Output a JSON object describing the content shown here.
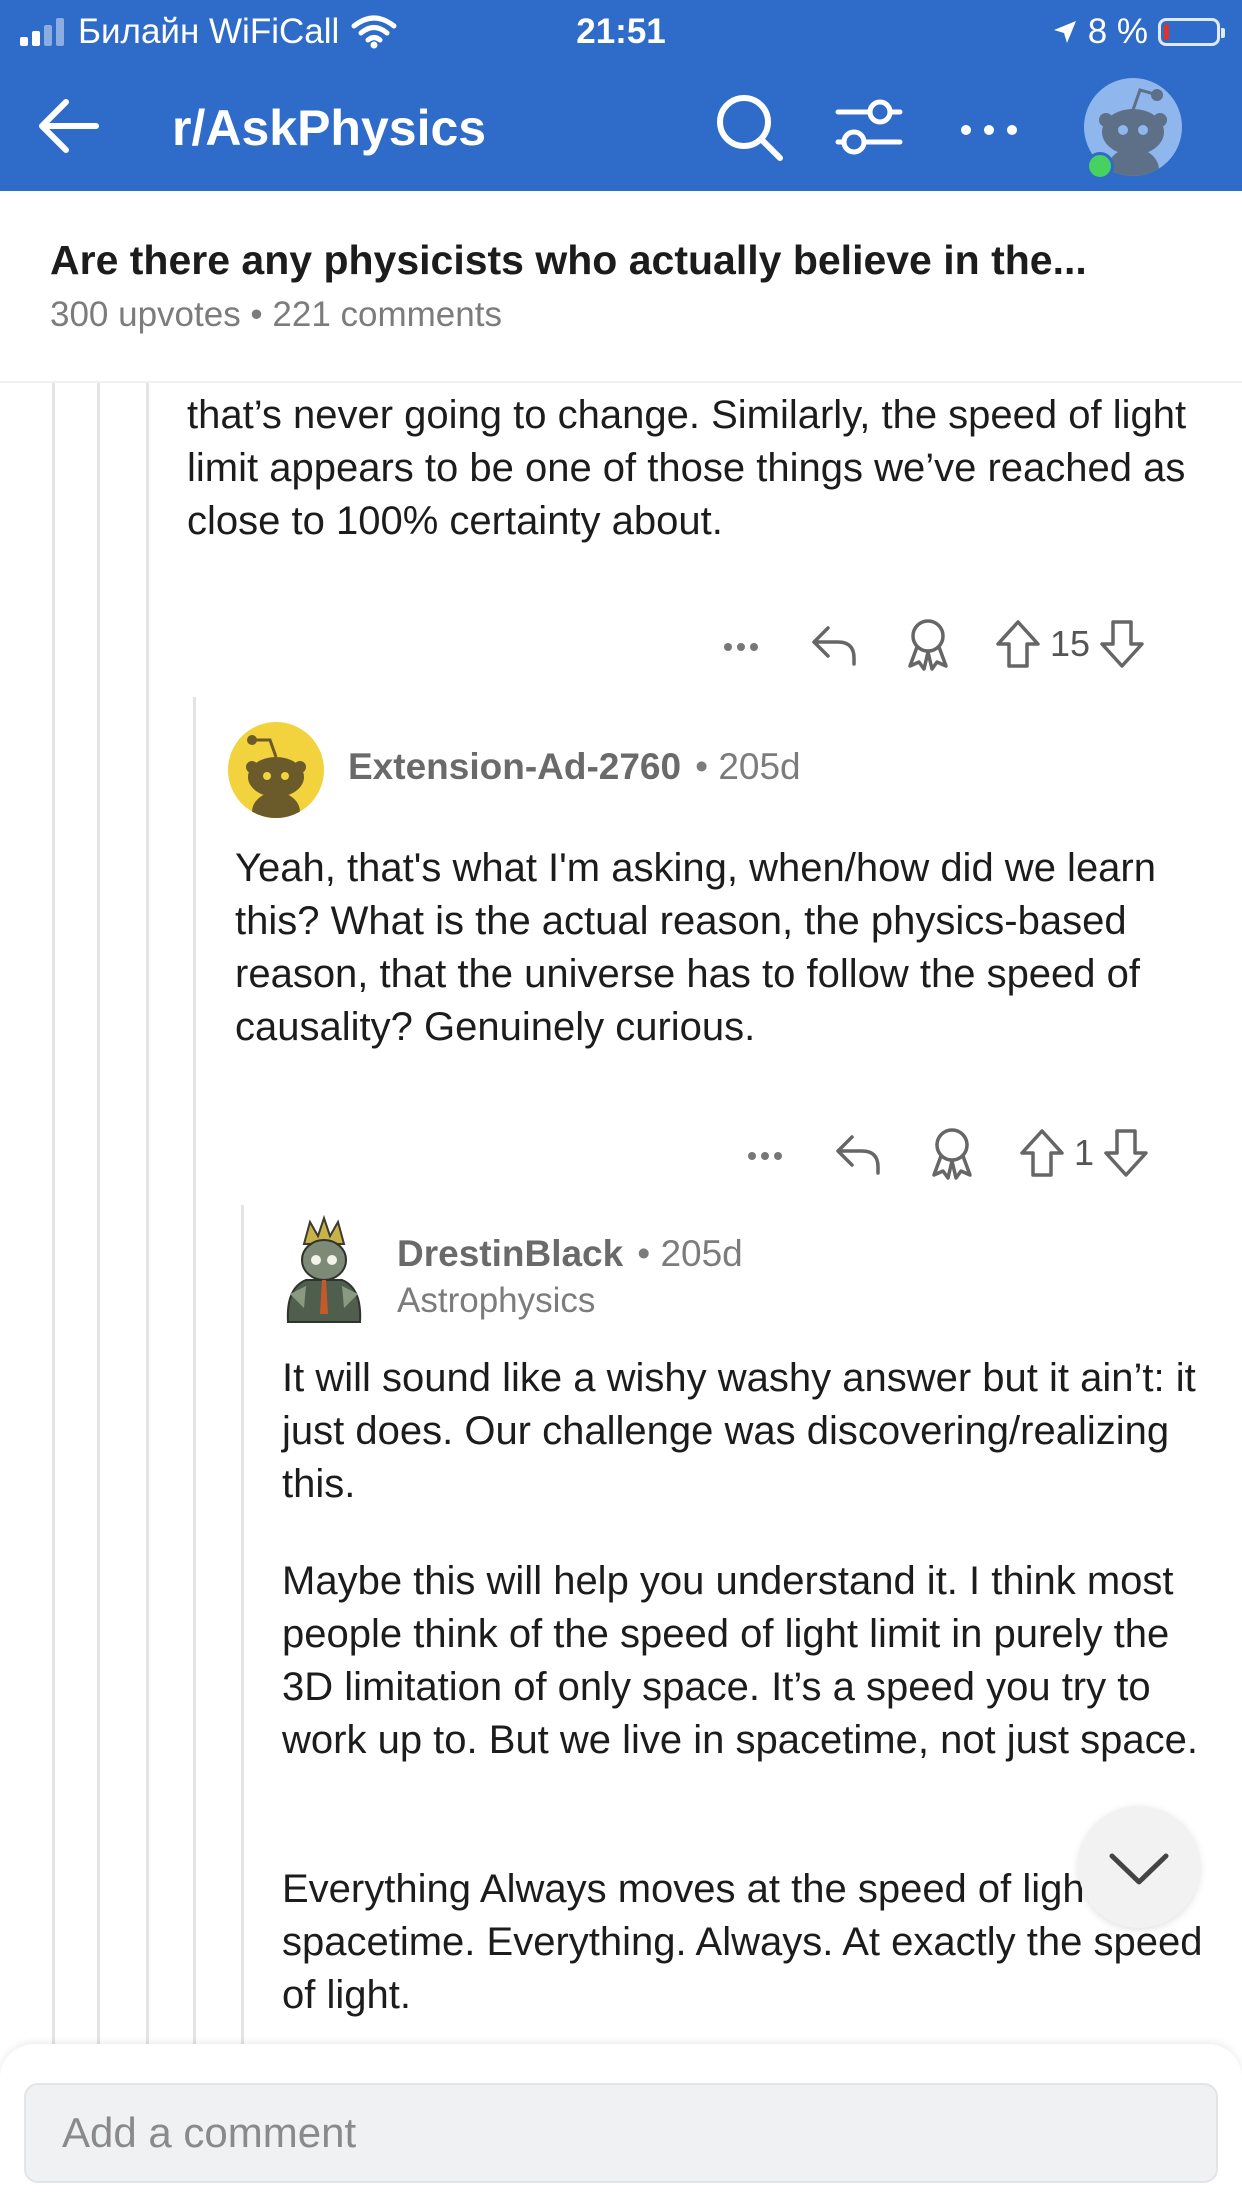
{
  "status_bar": {
    "carrier": "Билайн WiFiCall",
    "time": "21:51",
    "battery": "8 %",
    "battery_level": 0.08
  },
  "nav": {
    "title": "r/AskPhysics"
  },
  "post": {
    "title": "Are there any physicists who actually believe in the...",
    "meta": "300 upvotes • 221 comments"
  },
  "comments": [
    {
      "text": "that’s never going to change. Similarly, the speed of light limit appears to be one of those things we’ve reached as close to 100% certainty about.",
      "votes": "15"
    },
    {
      "author": "Extension-Ad-2760",
      "age": "• 205d",
      "text": "Yeah, that's what I'm asking, when/how did we learn this? What is the actual reason, the physics-based reason, that the universe has to follow the speed of causality? Genuinely curious.",
      "votes": "1"
    },
    {
      "author": "DrestinBlack",
      "age": "• 205d",
      "flair": "Astrophysics",
      "paragraphs": [
        "It will sound like a wishy washy answer but it ain’t: it just does. Our challenge was discovering/realizing this.",
        "Maybe this will help you understand it. I think most people think of the speed of light limit in purely the 3D limitation of only space. It’s a speed you try to work up to. But we live in spacetime, not just space.",
        "Everything Always moves at the speed of light in spacetime. Everything. Always. At exactly the speed of light."
      ]
    }
  ],
  "composer": {
    "placeholder": "Add a comment"
  },
  "icons": [
    "back-arrow-icon",
    "search-icon",
    "filter-icon",
    "more-icon",
    "snoo-avatar-icon",
    "more-dots-icon",
    "reply-icon",
    "award-icon",
    "upvote-icon",
    "downvote-icon",
    "chevron-down-icon"
  ],
  "colors": {
    "header": "#2f6bc8",
    "online": "#46d160",
    "battery_low": "#e0312b"
  }
}
